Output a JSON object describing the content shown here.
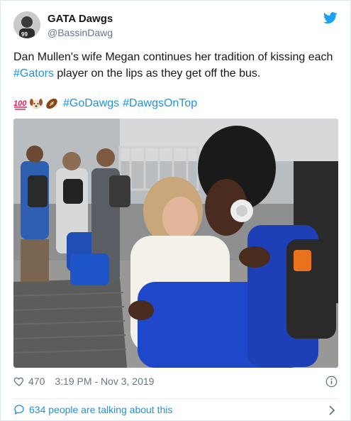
{
  "tweet": {
    "display_name": "GATA Dawgs",
    "handle": "@BassinDawg",
    "text_before": "Dan Mullen's wife Megan continues her tradition of kissing each ",
    "hashtag_gators": "#Gators",
    "text_after": " player on the lips as they get off the bus.",
    "emojis": [
      "hundred-points-emoji",
      "dog-face-emoji",
      "football-emoji"
    ],
    "hashtag_godawgs": "#GoDawgs",
    "hashtag_dawgsontop": "#DawgsOnTop",
    "likes": "470",
    "timestamp": "3:19 PM - Nov 3, 2019",
    "talking": "634 people are talking about this"
  },
  "colors": {
    "link": "#1b95e0",
    "muted": "#657786",
    "twitter_blue": "#1da1f2"
  }
}
